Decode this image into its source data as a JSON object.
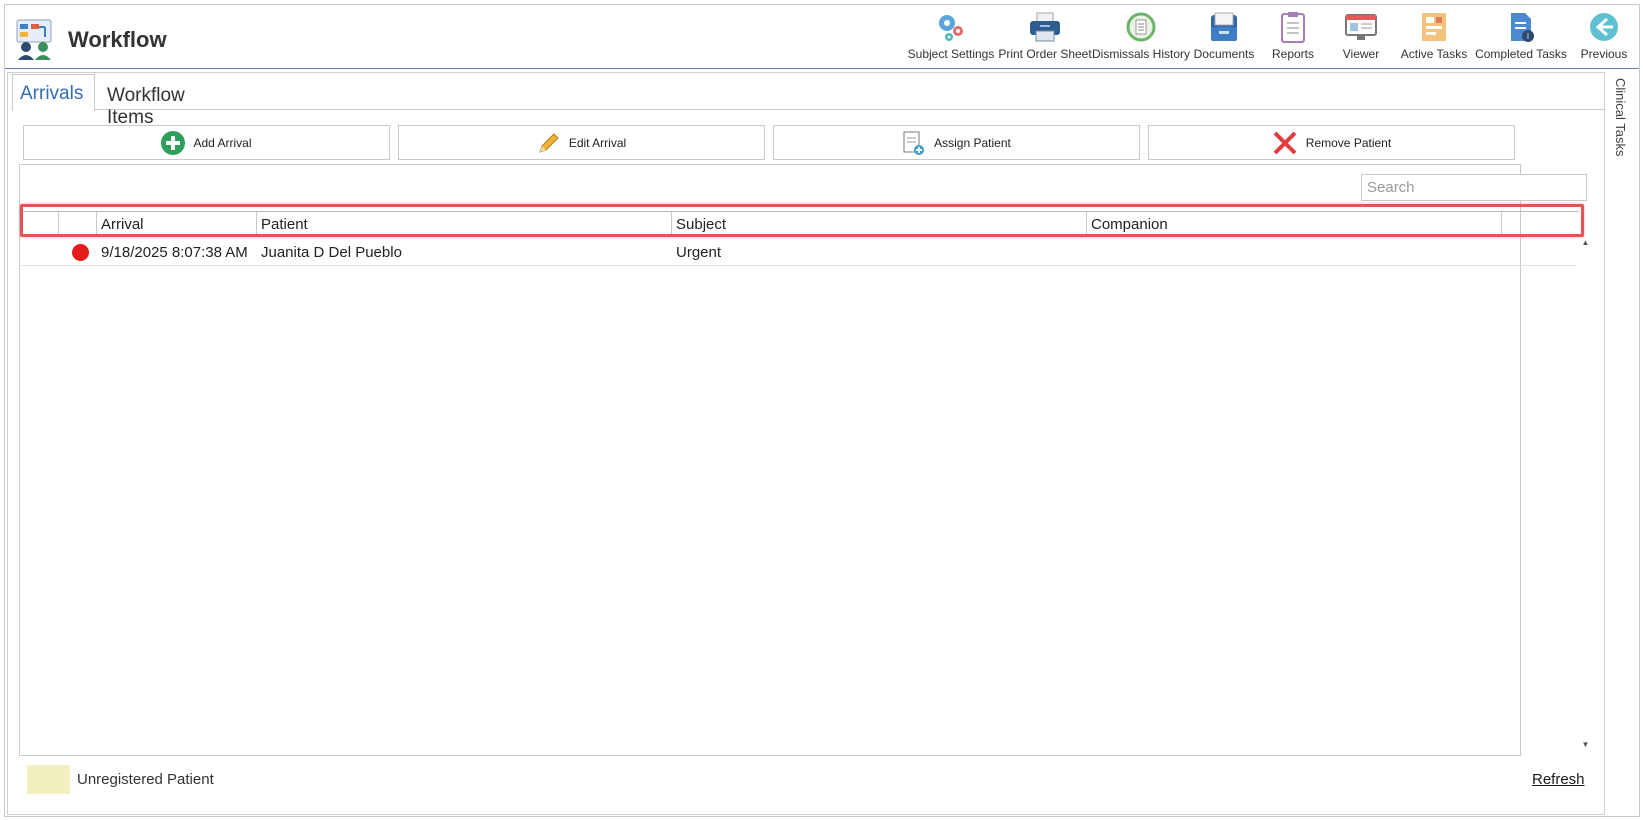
{
  "app": {
    "title": "Workflow"
  },
  "toolbar": {
    "items": [
      {
        "label": "Subject Settings",
        "icon": "gears-icon"
      },
      {
        "label": "Print Order Sheet",
        "icon": "printer-icon"
      },
      {
        "label": "Dismissals History",
        "icon": "history-icon"
      },
      {
        "label": "Documents",
        "icon": "file-tray-icon"
      },
      {
        "label": "Reports",
        "icon": "clipboard-icon"
      },
      {
        "label": "Viewer",
        "icon": "monitor-icon"
      },
      {
        "label": "Active Tasks",
        "icon": "task-board-icon"
      },
      {
        "label": "Completed Tasks",
        "icon": "completed-doc-icon"
      },
      {
        "label": "Previous",
        "icon": "back-arrow-icon"
      }
    ]
  },
  "side_panel": {
    "label": "Clinical Tasks"
  },
  "tabs": [
    {
      "label": "Arrivals",
      "active": true
    },
    {
      "label": "Workflow Items",
      "active": false
    }
  ],
  "actions": [
    {
      "label": "Add Arrival",
      "icon": "plus-circle-icon"
    },
    {
      "label": "Edit Arrival",
      "icon": "pencil-icon"
    },
    {
      "label": "Assign Patient",
      "icon": "assign-doc-icon"
    },
    {
      "label": "Remove Patient",
      "icon": "red-x-icon"
    }
  ],
  "search": {
    "placeholder": "Search"
  },
  "grid": {
    "columns": [
      "",
      "",
      "Arrival",
      "Patient",
      "Subject",
      "Companion"
    ],
    "rows": [
      {
        "status_color": "#e41c1c",
        "arrival": "9/18/2025 8:07:38 AM",
        "patient": "Juanita D Del Pueblo",
        "subject": "Urgent",
        "companion": ""
      }
    ]
  },
  "legend": {
    "label": "Unregistered Patient",
    "color": "#f3f0c0"
  },
  "refresh": {
    "label": "Refresh"
  },
  "colors": {
    "accent": "#2f6db5",
    "header_rule": "#5a7fb5",
    "highlight": "#e05656"
  }
}
